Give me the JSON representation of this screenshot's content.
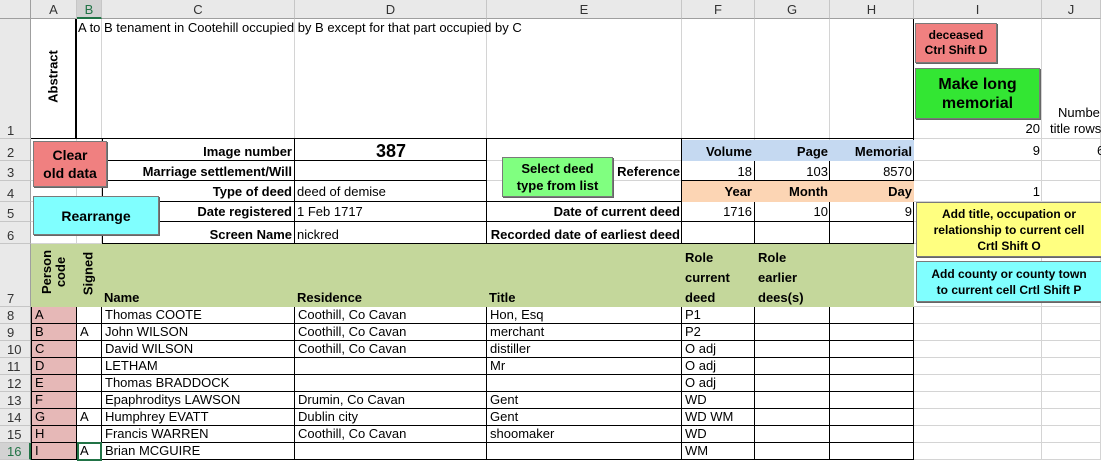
{
  "columns": [
    "A",
    "B",
    "C",
    "D",
    "E",
    "F",
    "G",
    "H",
    "I",
    "J"
  ],
  "rows": [
    "1",
    "2",
    "3",
    "4",
    "5",
    "6",
    "7",
    "8",
    "9",
    "10",
    "11",
    "12",
    "13",
    "14",
    "15",
    "16"
  ],
  "abstract_label": "Abstract",
  "abstract_text": "A to B tenament in Cootehill occupied by B except for that part occupied by C",
  "buttons": {
    "deceased": [
      "deceased",
      "Ctrl  Shift D"
    ],
    "make_long": [
      "Make long",
      "memorial"
    ],
    "clear_old": [
      "Clear",
      "old data"
    ],
    "rearrange": "Rearrange",
    "select_deed": [
      "Select deed",
      "type from list"
    ],
    "add_title": [
      "Add title, occupation or",
      "relationship to current cell",
      "Crtl Shift O"
    ],
    "add_county": [
      "Add county or county town",
      "to current cell Crtl Shift P"
    ]
  },
  "form": {
    "image_number_label": "Image number",
    "image_number": "387",
    "marriage_label": "Marriage settlement/Will",
    "type_label": "Type of deed",
    "type_value": "deed of demise",
    "date_reg_label": "Date registered",
    "date_reg_value": "1 Feb 1717",
    "screen_name_label": "Screen Name",
    "screen_name_value": "nickred",
    "reference_label": "Reference",
    "current_deed_label": "Date of current deed",
    "earliest_label": "Recorded date of earliest deed"
  },
  "ref": {
    "volume_label": "Volume",
    "page_label": "Page",
    "memorial_label": "Memorial",
    "volume": "18",
    "page": "103",
    "memorial": "8570",
    "year_label": "Year",
    "month_label": "Month",
    "day_label": "Day",
    "year": "1716",
    "month": "10",
    "day": "9"
  },
  "side": {
    "i1": "20",
    "j1": "Numbe",
    "j1b": "title rows",
    "i2": "9",
    "j2": "6",
    "i4": "1"
  },
  "table_headers": {
    "person_code": [
      "Person",
      "code"
    ],
    "signed": "Signed",
    "name": "Name",
    "residence": "Residence",
    "title": "Title",
    "role_current": [
      "Role",
      "current",
      "deed"
    ],
    "role_earlier": [
      "Role",
      "earlier",
      "dees(s)"
    ]
  },
  "people": [
    {
      "code": "A",
      "signed": "",
      "name": "Thomas COOTE",
      "residence": "Coothill, Co Cavan",
      "title": "Hon, Esq",
      "role": "P1"
    },
    {
      "code": "B",
      "signed": "A",
      "name": "John WILSON",
      "residence": "Coothill, Co Cavan",
      "title": "merchant",
      "role": "P2"
    },
    {
      "code": "C",
      "signed": "",
      "name": "David WILSON",
      "residence": "Coothill, Co Cavan",
      "title": "distiller",
      "role": "O adj"
    },
    {
      "code": "D",
      "signed": "",
      "name": "LETHAM",
      "residence": "",
      "title": "Mr",
      "role": "O adj"
    },
    {
      "code": "E",
      "signed": "",
      "name": "Thomas BRADDOCK",
      "residence": "",
      "title": "",
      "role": "O adj"
    },
    {
      "code": "F",
      "signed": "",
      "name": "Epaphroditys LAWSON",
      "residence": "Drumin, Co Cavan",
      "title": "Gent",
      "role": "WD"
    },
    {
      "code": "G",
      "signed": "A",
      "name": "Humphrey EVATT",
      "residence": "Dublin city",
      "title": "Gent",
      "role": "WD WM"
    },
    {
      "code": "H",
      "signed": "",
      "name": "Francis WARREN",
      "residence": "Coothill, Co Cavan",
      "title": "shoomaker",
      "role": "WD"
    },
    {
      "code": "I",
      "signed": "A",
      "name": "Brian MCGUIRE",
      "residence": "",
      "title": "",
      "role": "WM"
    }
  ],
  "colors": {
    "pink_btn": "#f08080",
    "green_btn": "#33e633",
    "light_green_btn": "#80ff80",
    "cyan_btn": "#80ffff",
    "yellow_btn": "#ffff80",
    "header_green": "#c4d79b",
    "blue_hdr": "#c5d9f1",
    "orange_hdr": "#fcd5b4",
    "pink_cell": "#e6b8b7"
  }
}
